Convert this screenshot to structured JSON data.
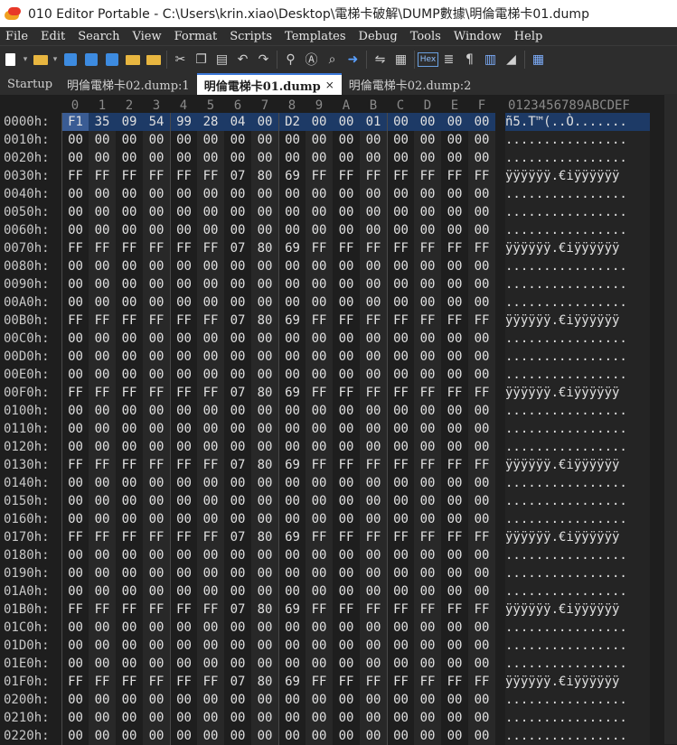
{
  "window": {
    "title": "010 Editor Portable - C:\\Users\\krin.xiao\\Desktop\\電梯卡破解\\DUMP數據\\明倫電梯卡01.dump"
  },
  "menu": [
    "File",
    "Edit",
    "Search",
    "View",
    "Format",
    "Scripts",
    "Templates",
    "Debug",
    "Tools",
    "Window",
    "Help"
  ],
  "toolbar": {
    "hex_label": "Hex",
    "pilcrow": "¶"
  },
  "tabs": [
    {
      "label": "Startup",
      "active": false
    },
    {
      "label": "明倫電梯卡02.dump:1",
      "active": false
    },
    {
      "label": "明倫電梯卡01.dump",
      "active": true,
      "close": "×"
    },
    {
      "label": "明倫電梯卡02.dump:2",
      "active": false
    }
  ],
  "hex_header": {
    "columns": [
      "0",
      "1",
      "2",
      "3",
      "4",
      "5",
      "6",
      "7",
      "8",
      "9",
      "A",
      "B",
      "C",
      "D",
      "E",
      "F"
    ],
    "ascii": "0123456789ABCDEF"
  },
  "patterns": {
    "zero": {
      "bytes": [
        "00",
        "00",
        "00",
        "00",
        "00",
        "00",
        "00",
        "00",
        "00",
        "00",
        "00",
        "00",
        "00",
        "00",
        "00",
        "00"
      ],
      "ascii": "................"
    },
    "trailer": {
      "bytes": [
        "FF",
        "FF",
        "FF",
        "FF",
        "FF",
        "FF",
        "07",
        "80",
        "69",
        "FF",
        "FF",
        "FF",
        "FF",
        "FF",
        "FF",
        "FF"
      ],
      "ascii": "ÿÿÿÿÿÿ.€iÿÿÿÿÿÿ"
    }
  },
  "rows": [
    {
      "addr": "0000h:",
      "bytes": [
        "F1",
        "35",
        "09",
        "54",
        "99",
        "28",
        "04",
        "00",
        "D2",
        "00",
        "00",
        "01",
        "00",
        "00",
        "00",
        "00"
      ],
      "ascii": "ñ5.T™(..Ò.......",
      "selected": true
    },
    {
      "addr": "0010h:",
      "type": "zero"
    },
    {
      "addr": "0020h:",
      "type": "zero"
    },
    {
      "addr": "0030h:",
      "type": "trailer"
    },
    {
      "addr": "0040h:",
      "type": "zero"
    },
    {
      "addr": "0050h:",
      "type": "zero"
    },
    {
      "addr": "0060h:",
      "type": "zero"
    },
    {
      "addr": "0070h:",
      "type": "trailer"
    },
    {
      "addr": "0080h:",
      "type": "zero"
    },
    {
      "addr": "0090h:",
      "type": "zero"
    },
    {
      "addr": "00A0h:",
      "type": "zero"
    },
    {
      "addr": "00B0h:",
      "type": "trailer"
    },
    {
      "addr": "00C0h:",
      "type": "zero"
    },
    {
      "addr": "00D0h:",
      "type": "zero"
    },
    {
      "addr": "00E0h:",
      "type": "zero"
    },
    {
      "addr": "00F0h:",
      "type": "trailer"
    },
    {
      "addr": "0100h:",
      "type": "zero"
    },
    {
      "addr": "0110h:",
      "type": "zero"
    },
    {
      "addr": "0120h:",
      "type": "zero"
    },
    {
      "addr": "0130h:",
      "type": "trailer"
    },
    {
      "addr": "0140h:",
      "type": "zero"
    },
    {
      "addr": "0150h:",
      "type": "zero"
    },
    {
      "addr": "0160h:",
      "type": "zero"
    },
    {
      "addr": "0170h:",
      "type": "trailer"
    },
    {
      "addr": "0180h:",
      "type": "zero"
    },
    {
      "addr": "0190h:",
      "type": "zero"
    },
    {
      "addr": "01A0h:",
      "type": "zero"
    },
    {
      "addr": "01B0h:",
      "type": "trailer"
    },
    {
      "addr": "01C0h:",
      "type": "zero"
    },
    {
      "addr": "01D0h:",
      "type": "zero"
    },
    {
      "addr": "01E0h:",
      "type": "zero"
    },
    {
      "addr": "01F0h:",
      "type": "trailer"
    },
    {
      "addr": "0200h:",
      "type": "zero"
    },
    {
      "addr": "0210h:",
      "type": "zero"
    },
    {
      "addr": "0220h:",
      "type": "zero"
    }
  ]
}
